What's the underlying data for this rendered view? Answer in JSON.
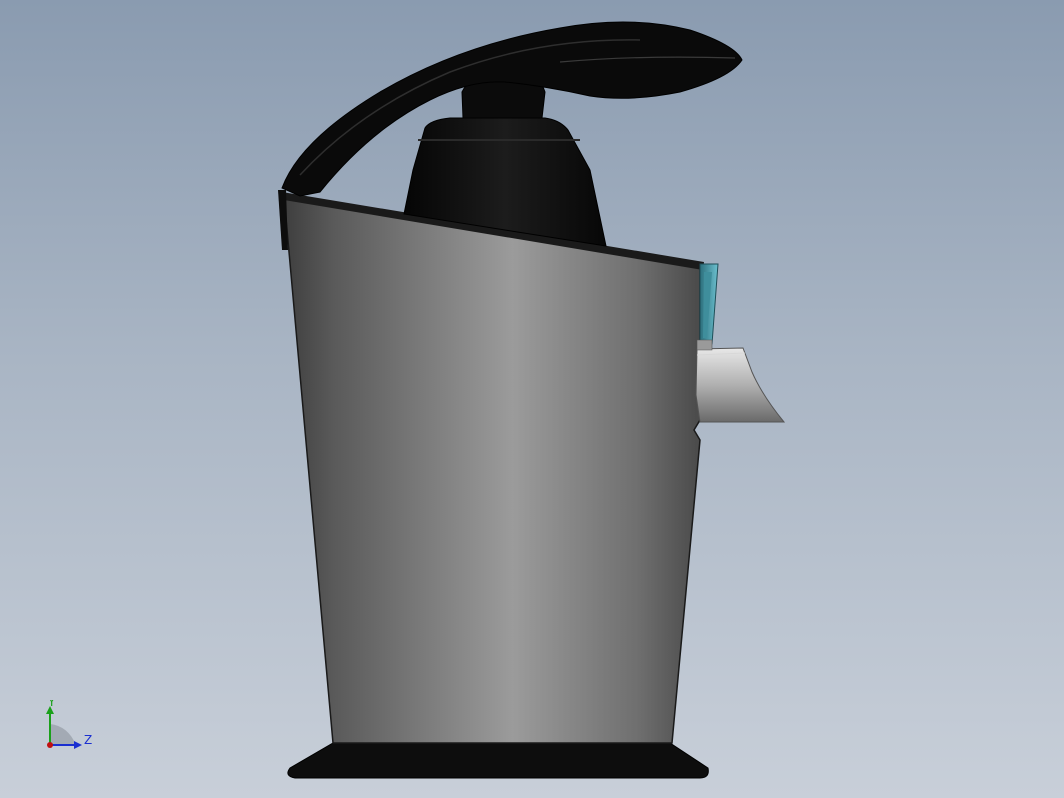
{
  "viewport": {
    "background_top": "#8a9bb0",
    "background_bottom": "#c8cfd9"
  },
  "model": {
    "kind": "citrus-juicer-side-view",
    "parts": [
      "handle-lever",
      "press-cone",
      "body-shell",
      "base-plate",
      "spout",
      "drip-tab"
    ],
    "colors": {
      "handle": "#0a0a0a",
      "body_light": "#9a9a9a",
      "body_dark": "#4a4a4a",
      "base": "#0d0d0d",
      "drip_tab": "#4b9fb0",
      "spout": "#b5b5b5"
    }
  },
  "triad": {
    "y_label": "Y",
    "z_label": "Z",
    "y_color": "#1aa01a",
    "z_color": "#1a2fd0",
    "x_color": "#c01010"
  }
}
